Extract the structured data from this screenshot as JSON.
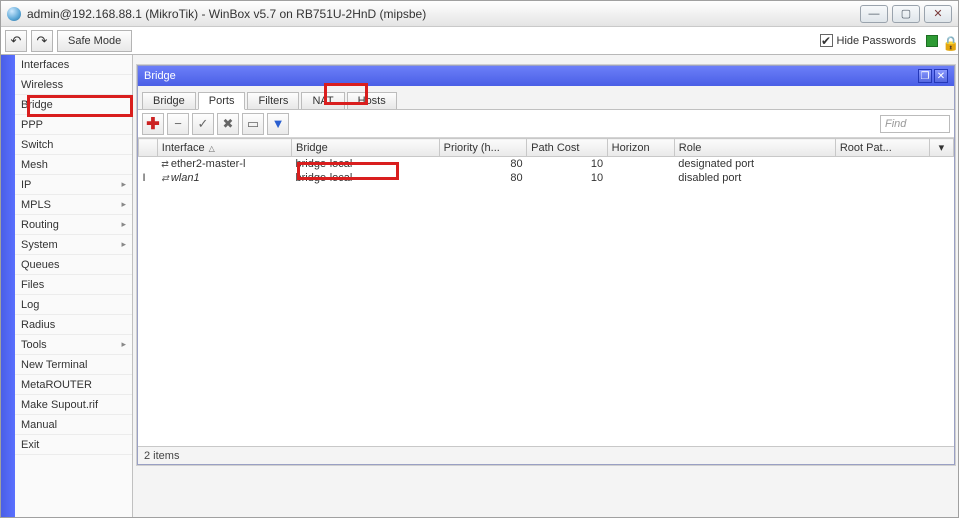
{
  "titlebar": {
    "title": "admin@192.168.88.1 (MikroTik) - WinBox v5.7 on RB751U-2HnD (mipsbe)"
  },
  "toolbar": {
    "undo_icon": "↶",
    "redo_icon": "↷",
    "safe_mode": "Safe Mode",
    "hide_passwords": "Hide Passwords"
  },
  "sidebar": {
    "items": [
      {
        "label": "Interfaces",
        "arrow": false
      },
      {
        "label": "Wireless",
        "arrow": false
      },
      {
        "label": "Bridge",
        "arrow": false
      },
      {
        "label": "PPP",
        "arrow": false
      },
      {
        "label": "Switch",
        "arrow": false
      },
      {
        "label": "Mesh",
        "arrow": false
      },
      {
        "label": "IP",
        "arrow": true
      },
      {
        "label": "MPLS",
        "arrow": true
      },
      {
        "label": "Routing",
        "arrow": true
      },
      {
        "label": "System",
        "arrow": true
      },
      {
        "label": "Queues",
        "arrow": false
      },
      {
        "label": "Files",
        "arrow": false
      },
      {
        "label": "Log",
        "arrow": false
      },
      {
        "label": "Radius",
        "arrow": false
      },
      {
        "label": "Tools",
        "arrow": true
      },
      {
        "label": "New Terminal",
        "arrow": false
      },
      {
        "label": "MetaROUTER",
        "arrow": false
      },
      {
        "label": "Make Supout.rif",
        "arrow": false
      },
      {
        "label": "Manual",
        "arrow": false
      },
      {
        "label": "Exit",
        "arrow": false
      }
    ]
  },
  "bridge_window": {
    "title": "Bridge",
    "tabs": [
      "Bridge",
      "Ports",
      "Filters",
      "NAT",
      "Hosts"
    ],
    "active_tab": 1,
    "find_placeholder": "Find",
    "columns": [
      "",
      "Interface",
      "Bridge",
      "Priority (h...",
      "Path Cost",
      "Horizon",
      "Role",
      "Root Pat...",
      ""
    ],
    "rows": [
      {
        "flag": "",
        "interface": "ether2-master-l",
        "bridge": "bridge-local",
        "priority": "80",
        "pathcost": "10",
        "horizon": "",
        "role": "designated port",
        "rootpath": ""
      },
      {
        "flag": "I",
        "interface": "wlan1",
        "bridge": "bridge-local",
        "priority": "80",
        "pathcost": "10",
        "horizon": "",
        "role": "disabled port",
        "rootpath": ""
      }
    ],
    "status": "2 items"
  },
  "icons": {
    "add": "✚",
    "remove": "−",
    "enable": "✓",
    "disable": "✖",
    "comment": "▭",
    "filter": "▾"
  }
}
